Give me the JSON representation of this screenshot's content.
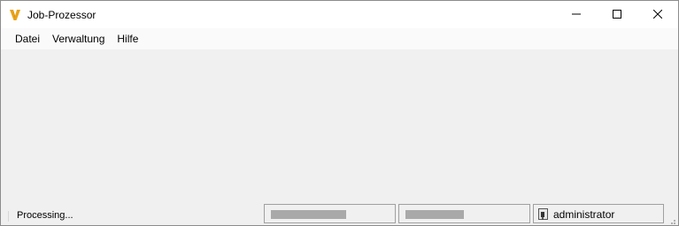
{
  "window": {
    "title": "Job-Prozessor",
    "icon": "vault-logo-icon",
    "controls": [
      "minimize-icon",
      "maximize-icon",
      "close-icon"
    ]
  },
  "menu": {
    "items": [
      {
        "label": "Datei"
      },
      {
        "label": "Verwaltung"
      },
      {
        "label": "Hilfe"
      }
    ]
  },
  "statusbar": {
    "status_text": "Processing...",
    "user": "administrator"
  },
  "colors": {
    "accent": "#e8a317",
    "window_bg": "#f0f0f0",
    "titlebar_bg": "#ffffff"
  }
}
